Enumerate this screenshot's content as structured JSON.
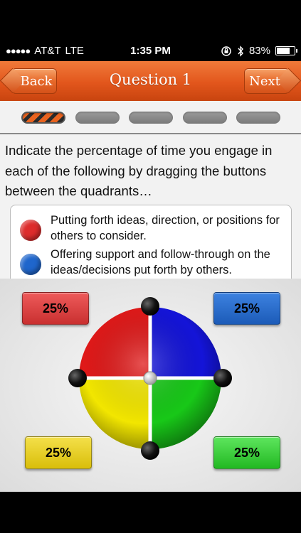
{
  "status_bar": {
    "signal_dots": "●●●●●",
    "carrier": "AT&T",
    "network": "LTE",
    "time": "1:35 PM",
    "battery_percent": "83%",
    "battery_level": 0.83
  },
  "nav": {
    "back_label": "Back",
    "title": "Question 1",
    "next_label": "Next"
  },
  "progress": {
    "total_steps": 5,
    "current_step": 1
  },
  "question": {
    "text": "Indicate the percentage of time you engage in each of the following by dragging the buttons between the quadrants…"
  },
  "legend": {
    "items": [
      {
        "color": "#dd2c2c",
        "text": "Putting forth ideas, direction, or positions for others to consider."
      },
      {
        "color": "#1f66cc",
        "text": "Offering support and follow-through on the ideas/decisions put forth by others."
      }
    ]
  },
  "quadrants": {
    "red": {
      "value": "25%",
      "color": "#e01919"
    },
    "blue": {
      "value": "25%",
      "color": "#1414d8"
    },
    "yellow": {
      "value": "25%",
      "color": "#f2e600"
    },
    "green": {
      "value": "25%",
      "color": "#18c818"
    }
  }
}
